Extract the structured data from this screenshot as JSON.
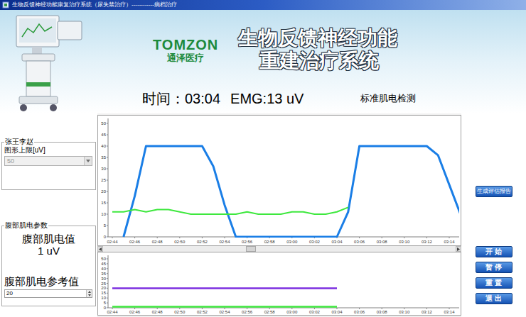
{
  "window": {
    "title": "生物反馈神经功能康复治疗系统（尿失禁治疗）------------病档治疗"
  },
  "header": {
    "logo": {
      "brand": "TOMZON",
      "subtitle": "通泽医疗"
    },
    "title_lines": [
      "生物反馈神经功能",
      "重建治疗系统"
    ]
  },
  "status": {
    "time": "时间：03:04",
    "emg": "EMG:13 uV",
    "mode": "标准肌电检测"
  },
  "patient_panel": {
    "name": "张王李赵",
    "limit_label": "图形上限[uV]",
    "limit_value": "50",
    "limit_disabled": true
  },
  "abdominal_panel": {
    "title": "腹部肌电参数",
    "value_label": "腹部肌电值",
    "value": "1 uV",
    "reference_label": "腹部肌电参考值",
    "reference_value": "20"
  },
  "main_chart": {
    "y_ticks": [
      "0",
      "5",
      "10",
      "15",
      "20",
      "25",
      "30",
      "35",
      "40",
      "45",
      "50"
    ],
    "x_ticks": [
      "02:44",
      "02:46",
      "02:48",
      "02:50",
      "02:52",
      "02:54",
      "02:56",
      "02:58",
      "03:00",
      "03:02",
      "03:04",
      "03:06",
      "03:08",
      "03:10",
      "03:12",
      "03:14"
    ],
    "series": [
      {
        "color": "#1a7ee6",
        "values": [
          null,
          0,
          18,
          40,
          40,
          40,
          40,
          40,
          40,
          31,
          14,
          0,
          0,
          0,
          0,
          0,
          0,
          0,
          0,
          0,
          0,
          11,
          40,
          40,
          40,
          40,
          40,
          40,
          40,
          36,
          23,
          10
        ]
      },
      {
        "color": "#3ee83e",
        "values": [
          11,
          11,
          12,
          11,
          12,
          12,
          11,
          10,
          10,
          10,
          10,
          10,
          11,
          10,
          10,
          10,
          11,
          11,
          10,
          10,
          11,
          13
        ]
      }
    ]
  },
  "scrollbar": {
    "level": 0.42
  },
  "sub_chart": {
    "y_ticks": [
      "0",
      "5",
      "10",
      "15",
      "20",
      "25",
      "30",
      "35",
      "40",
      "45",
      "50"
    ],
    "x_ticks": [
      "02:44",
      "02:46",
      "02:48",
      "02:50",
      "02:52",
      "02:54",
      "02:56",
      "02:58",
      "03:00",
      "03:02",
      "03:04",
      "03:06",
      "03:08",
      "03:10",
      "03:12",
      "03:14"
    ],
    "series": [
      {
        "color": "#7b2ee0",
        "values": [
          20,
          20,
          20,
          20,
          20,
          20,
          20,
          20,
          20,
          20,
          20,
          20,
          20,
          20,
          20,
          20,
          20,
          20,
          20,
          20,
          20
        ]
      },
      {
        "color": "#3ee83e",
        "values": [
          1,
          1,
          1,
          1,
          1,
          1,
          1,
          1,
          1,
          1,
          1,
          1,
          1,
          1,
          1,
          1,
          1,
          1,
          1,
          1,
          1
        ]
      }
    ]
  },
  "report_button": "生成评估报告",
  "buttons": [
    "开 始",
    "暂 停",
    "重 置",
    "退 出"
  ]
}
